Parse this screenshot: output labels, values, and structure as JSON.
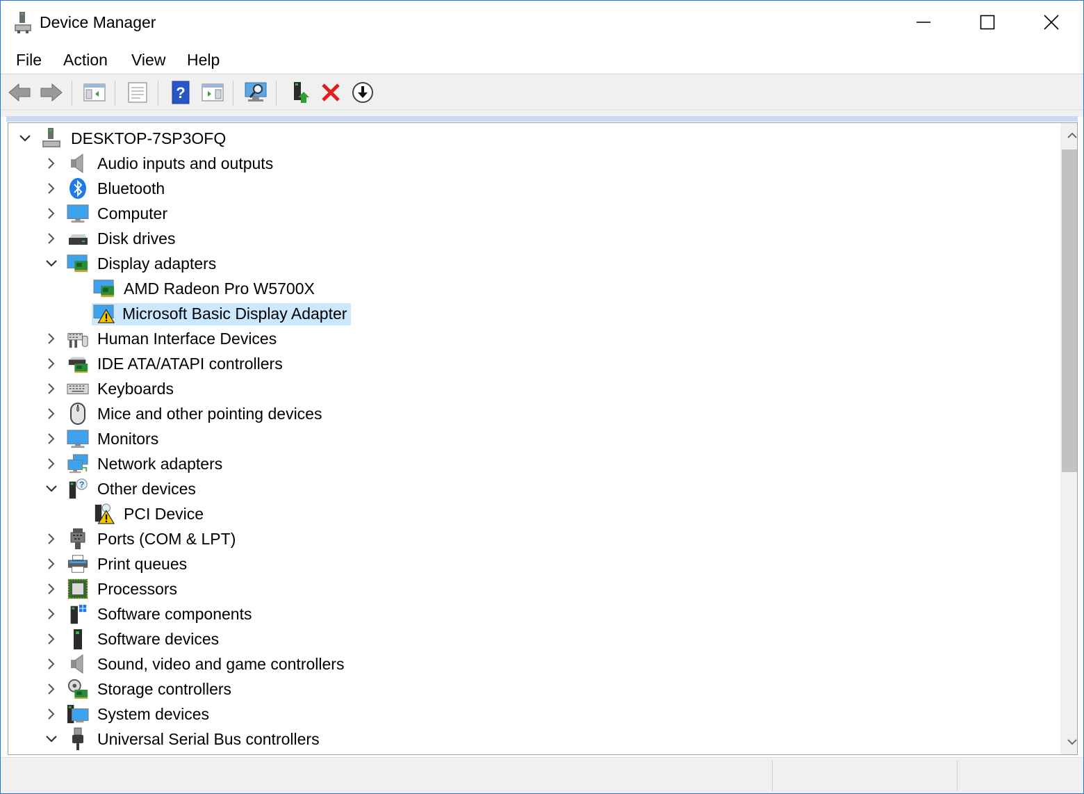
{
  "window": {
    "title": "Device Manager",
    "icon": "device-manager-icon"
  },
  "menu": {
    "file": "File",
    "action": "Action",
    "view": "View",
    "help": "Help"
  },
  "toolbar": {
    "icons": [
      "back-arrow-icon",
      "forward-arrow-icon",
      "show-hide-console-tree-icon",
      "properties-icon",
      "help-icon",
      "action-pane-icon",
      "scan-hardware-changes-icon",
      "update-driver-icon",
      "uninstall-device-icon",
      "disable-device-icon"
    ]
  },
  "tree": {
    "root": "DESKTOP-7SP3OFQ",
    "categories": {
      "audio": "Audio inputs and outputs",
      "bluetooth": "Bluetooth",
      "computer": "Computer",
      "disk": "Disk drives",
      "display": "Display adapters",
      "display_child_1": "AMD Radeon Pro W5700X",
      "display_child_2": "Microsoft Basic Display Adapter",
      "hid": "Human Interface Devices",
      "ide": "IDE ATA/ATAPI controllers",
      "keyboards": "Keyboards",
      "mice": "Mice and other pointing devices",
      "monitors": "Monitors",
      "network": "Network adapters",
      "other": "Other devices",
      "other_child_1": "PCI Device",
      "ports": "Ports (COM & LPT)",
      "print": "Print queues",
      "processors": "Processors",
      "software_components": "Software components",
      "software_devices": "Software devices",
      "sound": "Sound, video and game controllers",
      "storage": "Storage controllers",
      "system": "System devices",
      "usb": "Universal Serial Bus controllers"
    },
    "selected": "Microsoft Basic Display Adapter"
  },
  "colors": {
    "selection": "#cce8ff",
    "window_border": "#1f78d1",
    "toolbar_bg": "#f0f0f0",
    "warning_yellow": "#f5c400"
  }
}
